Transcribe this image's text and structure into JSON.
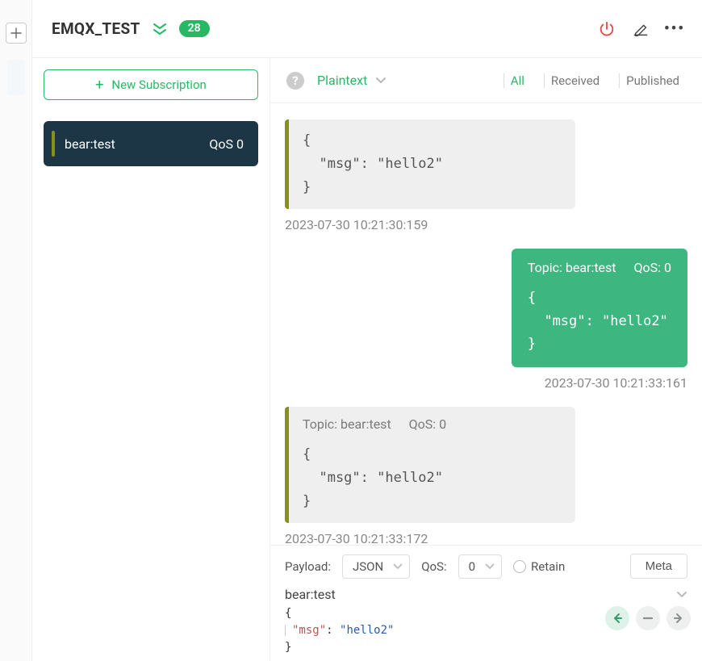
{
  "header": {
    "title": "EMQX_TEST",
    "badge_count": "28"
  },
  "sidebar": {
    "new_subscription_label": "New Subscription",
    "subscriptions": [
      {
        "topic": "bear:test",
        "qos_label": "QoS 0"
      }
    ]
  },
  "message_bar": {
    "format": "Plaintext",
    "filters": {
      "all": "All",
      "received": "Received",
      "published": "Published"
    }
  },
  "messages": [
    {
      "type": "received",
      "body": "{\n  \"msg\": \"hello2\"\n}",
      "timestamp": "2023-07-30 10:21:30:159"
    },
    {
      "type": "sent",
      "topic_label": "Topic: bear:test",
      "qos_label": "QoS: 0",
      "body": "{\n  \"msg\": \"hello2\"\n}",
      "timestamp": "2023-07-30 10:21:33:161"
    },
    {
      "type": "received",
      "topic_label": "Topic: bear:test",
      "qos_label": "QoS: 0",
      "body": "{\n  \"msg\": \"hello2\"\n}",
      "timestamp": "2023-07-30 10:21:33:172"
    }
  ],
  "editor": {
    "payload_label": "Payload:",
    "payload_format": "JSON",
    "qos_label": "QoS:",
    "qos_value": "0",
    "retain_label": "Retain",
    "meta_label": "Meta",
    "topic": "bear:test",
    "body_key": "\"msg\"",
    "body_val": "\"hello2\"",
    "brace_open": "{",
    "brace_close": "}",
    "colon_sep": ": "
  }
}
